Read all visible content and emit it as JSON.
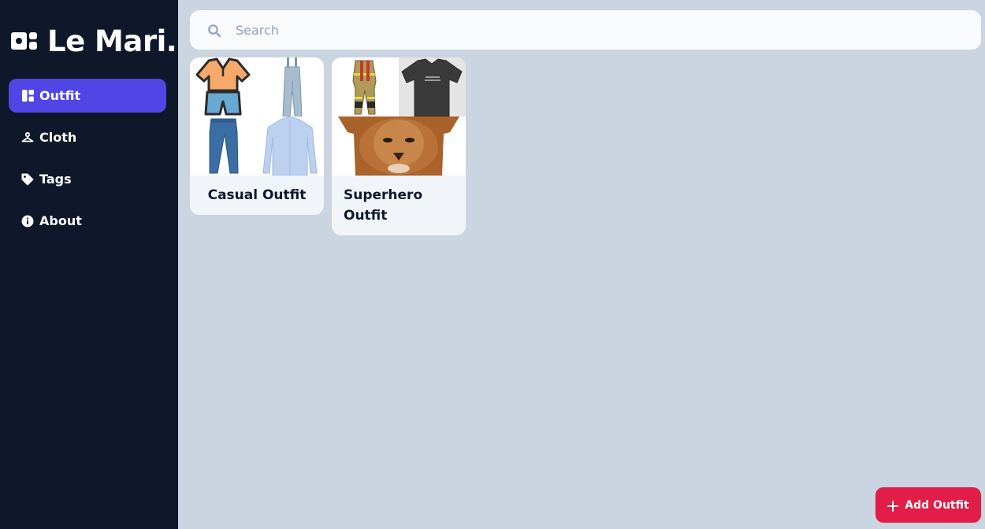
{
  "app": {
    "name": "Le Mari."
  },
  "sidebar": {
    "items": [
      {
        "label": "Outfit",
        "icon": "dashboard-icon",
        "active": true
      },
      {
        "label": "Cloth",
        "icon": "hanger-icon",
        "active": false
      },
      {
        "label": "Tags",
        "icon": "tag-icon",
        "active": false
      },
      {
        "label": "About",
        "icon": "info-icon",
        "active": false
      }
    ]
  },
  "search": {
    "placeholder": "Search",
    "value": ""
  },
  "outfits": [
    {
      "title": "Casual Outfit",
      "images": [
        "polo-shirt-and-shorts-image",
        "denim-overalls-image",
        "blue-jeans-image",
        "light-blue-shirt-image"
      ]
    },
    {
      "title": "Superhero Outfit",
      "images": [
        "firefighter-suit-image",
        "black-tshirt-image",
        "lion-tshirt-image"
      ]
    }
  ],
  "fab": {
    "label": "Add Outfit"
  },
  "colors": {
    "sidebar_bg": "#0f172a",
    "active_nav": "#4f46e5",
    "content_bg": "#cbd5e1",
    "fab_bg": "#e11d48"
  }
}
